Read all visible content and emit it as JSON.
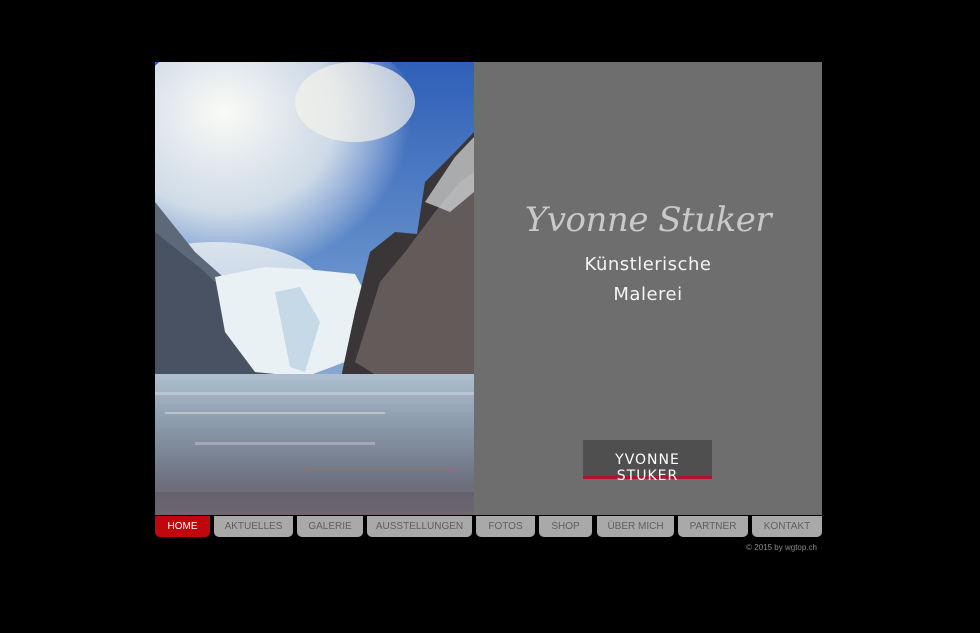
{
  "header": {
    "artist_script": "Yvonne Stuker",
    "tagline_line1": "Künstlerische",
    "tagline_line2": "Malerei",
    "logo_text": "YVONNE STUKER"
  },
  "nav": {
    "items": [
      {
        "label": "HOME",
        "active": true
      },
      {
        "label": "AKTUELLES",
        "active": false
      },
      {
        "label": "GALERIE",
        "active": false
      },
      {
        "label": "AUSSTELLUNGEN",
        "active": false
      },
      {
        "label": "FOTOS",
        "active": false
      },
      {
        "label": "SHOP",
        "active": false
      },
      {
        "label": "ÜBER MICH",
        "active": false
      },
      {
        "label": "PARTNER",
        "active": false
      },
      {
        "label": "KONTAKT",
        "active": false
      }
    ]
  },
  "footer": {
    "copyright": "© 2015 by wgtop.ch"
  },
  "colors": {
    "background": "#000000",
    "panel": "#6e6e6e",
    "nav_active": "#c0070d",
    "nav_inactive": "#a9a9a9",
    "logo_underline": "#b0142a"
  }
}
